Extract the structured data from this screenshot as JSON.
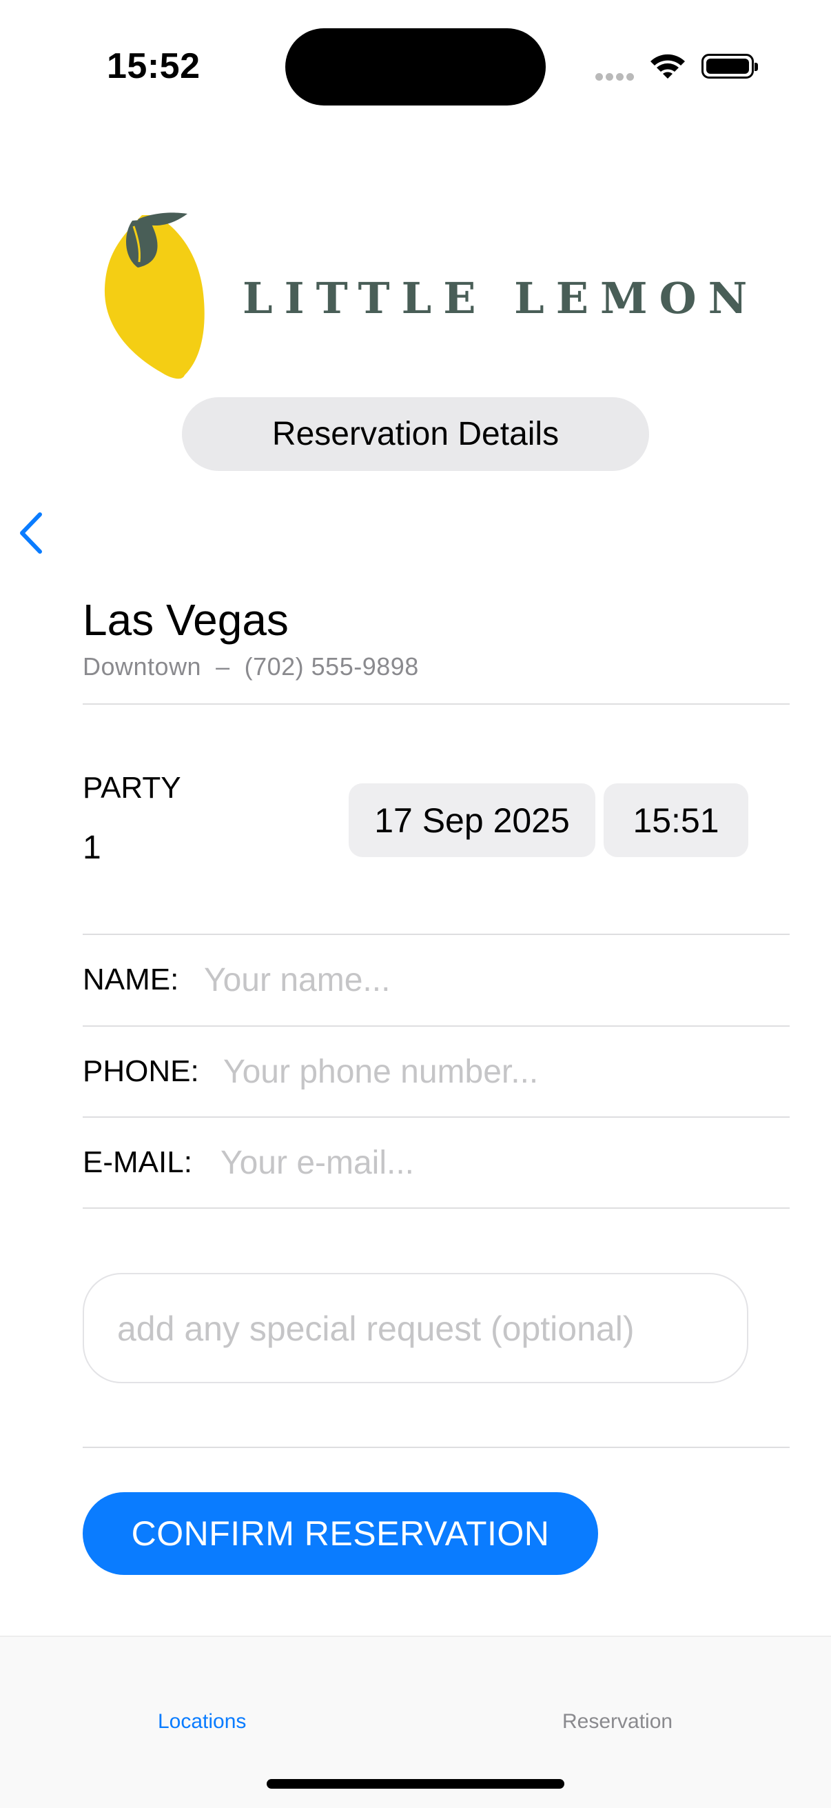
{
  "status_bar": {
    "time": "15:52"
  },
  "header": {
    "logo_text": "LITTLE LEMON",
    "title": "Reservation Details"
  },
  "location": {
    "city": "Las Vegas",
    "subtitle": "Downtown  –  (702) 555-9898"
  },
  "party": {
    "label": "PARTY",
    "value": "1"
  },
  "datetime": {
    "date": "17 Sep 2025",
    "time": "15:51"
  },
  "form": {
    "name_label": "NAME:",
    "name_placeholder": "Your name...",
    "phone_label": "PHONE:",
    "phone_placeholder": "Your phone number...",
    "email_label": "E-MAIL:",
    "email_placeholder": "Your e-mail...",
    "special_placeholder": "add any special request (optional)"
  },
  "confirm_label": "CONFIRM RESERVATION",
  "tabs": [
    {
      "label": "Locations",
      "active": true
    },
    {
      "label": "Reservation",
      "active": false
    }
  ],
  "colors": {
    "accent": "#0a7cff",
    "brand_green": "#495e57",
    "lemon": "#f4ce14"
  },
  "icons": [
    "wifi-icon",
    "battery-icon",
    "lemon-logo-icon",
    "back-chevron-icon"
  ]
}
